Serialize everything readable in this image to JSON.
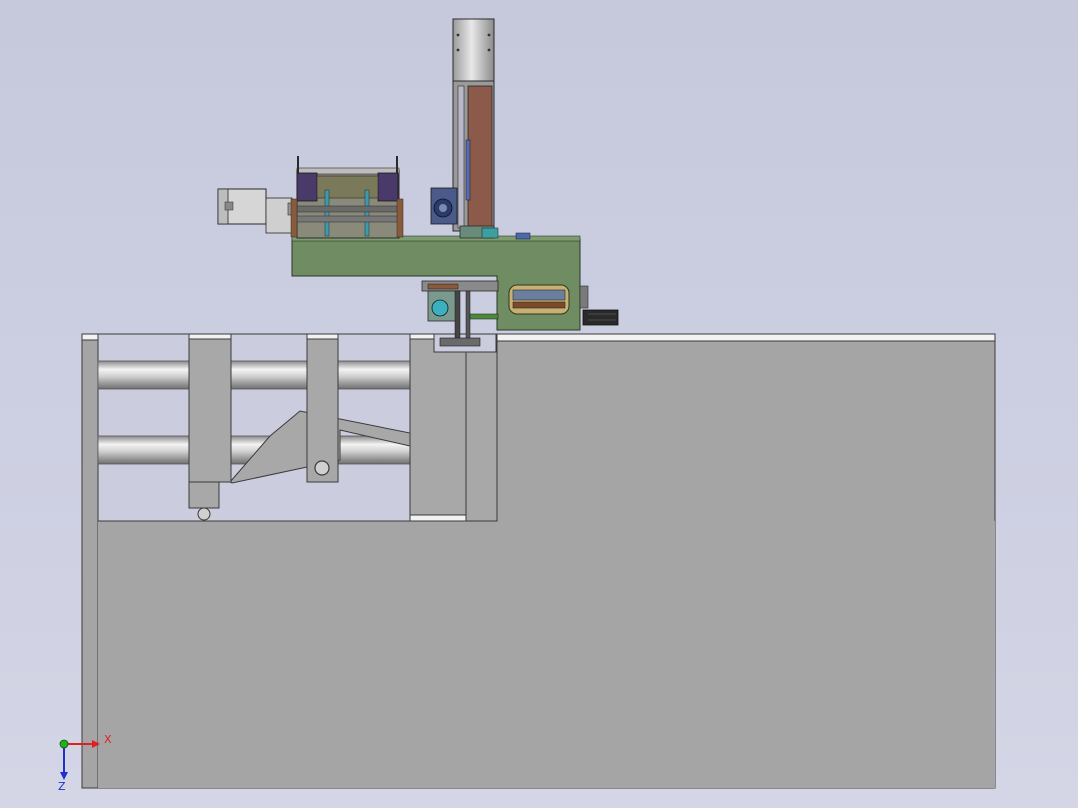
{
  "viewport": {
    "background_top": "#c6c8dc",
    "background_bottom": "#d4d6e6"
  },
  "triad": {
    "x_label": "X",
    "z_label": "Z",
    "x_color": "#e02020",
    "y_color": "#20b020",
    "z_color": "#2030d0"
  },
  "colors": {
    "base_grey": "#a5a5a5",
    "plate_green": "#6f8c62",
    "column_brown": "#8c5a4a",
    "motor_purple": "#4a3a6a",
    "rail_steel": "#d8d8d8"
  }
}
